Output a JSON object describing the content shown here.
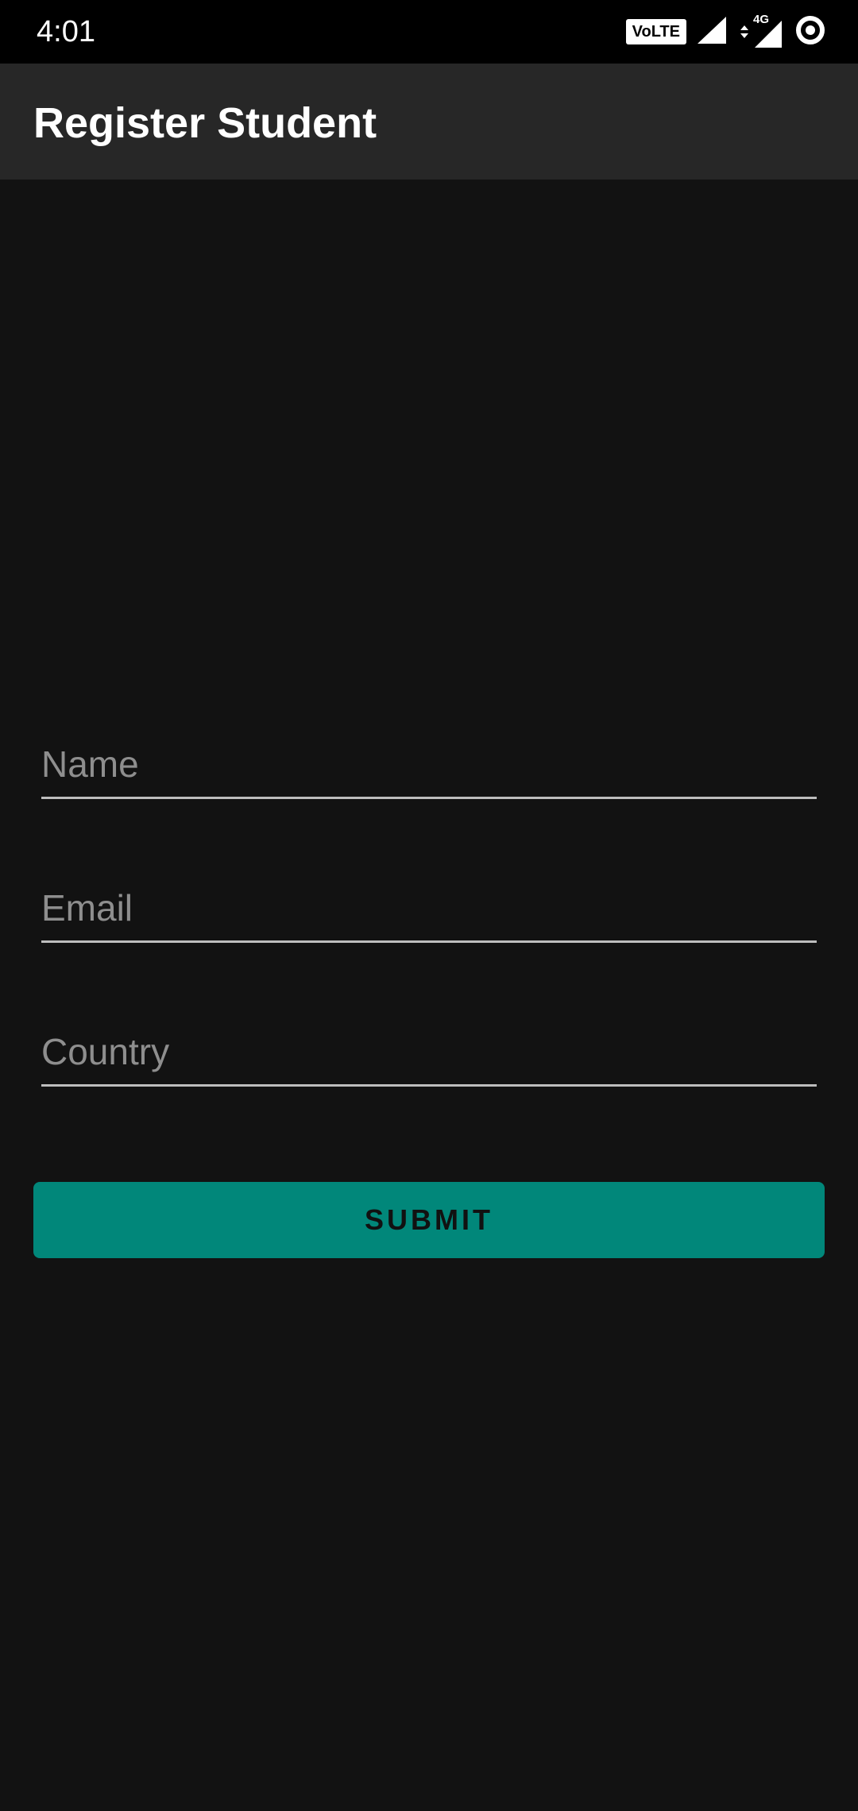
{
  "status_bar": {
    "time": "4:01",
    "volte_label": "VoLTE",
    "network_label": "4G",
    "icons": [
      "volte-icon",
      "signal-icon",
      "data-signal-icon",
      "sync-icon"
    ]
  },
  "app_bar": {
    "title": "Register Student"
  },
  "form": {
    "name_placeholder": "Name",
    "name_value": "",
    "email_placeholder": "Email",
    "email_value": "",
    "country_placeholder": "Country",
    "country_value": "",
    "submit_label": "SUBMIT"
  },
  "colors": {
    "background": "#121212",
    "app_bar": "#272727",
    "accent": "#01877a",
    "underline": "#bdbdbd",
    "placeholder": "#8e8e8e"
  }
}
